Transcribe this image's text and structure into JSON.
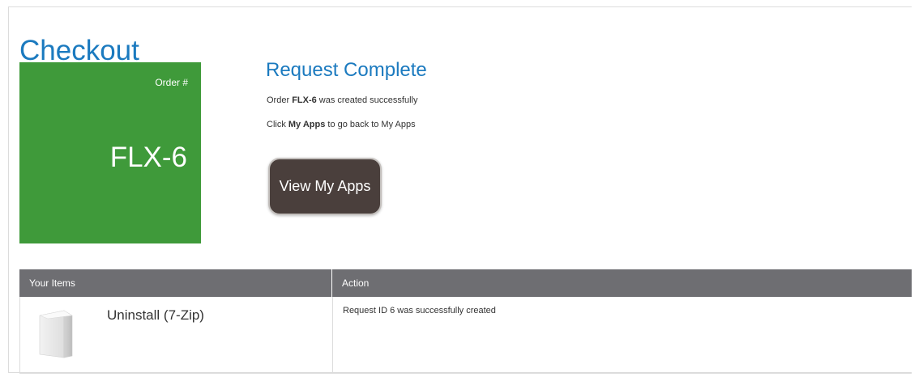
{
  "page": {
    "title": "Checkout"
  },
  "order": {
    "label": "Order #",
    "number": "FLX-6",
    "tile_color": "#3f9a3a"
  },
  "status": {
    "heading": "Request Complete",
    "line1_prefix": "Order ",
    "line1_bold": "FLX-6",
    "line1_suffix": " was created successfully",
    "line2_prefix": "Click ",
    "line2_bold": "My Apps",
    "line2_suffix": " to go back to My Apps"
  },
  "actions": {
    "view_apps_label": "View My Apps"
  },
  "table": {
    "headers": [
      "Your Items",
      "Action"
    ],
    "rows": [
      {
        "icon": "app-box-icon",
        "item": "Uninstall (7-Zip)",
        "action": "Request ID 6 was successfully created"
      }
    ]
  },
  "colors": {
    "accent_blue": "#1b7abf",
    "header_gray": "#6e6e72",
    "button_brown": "#4a3f3c"
  }
}
